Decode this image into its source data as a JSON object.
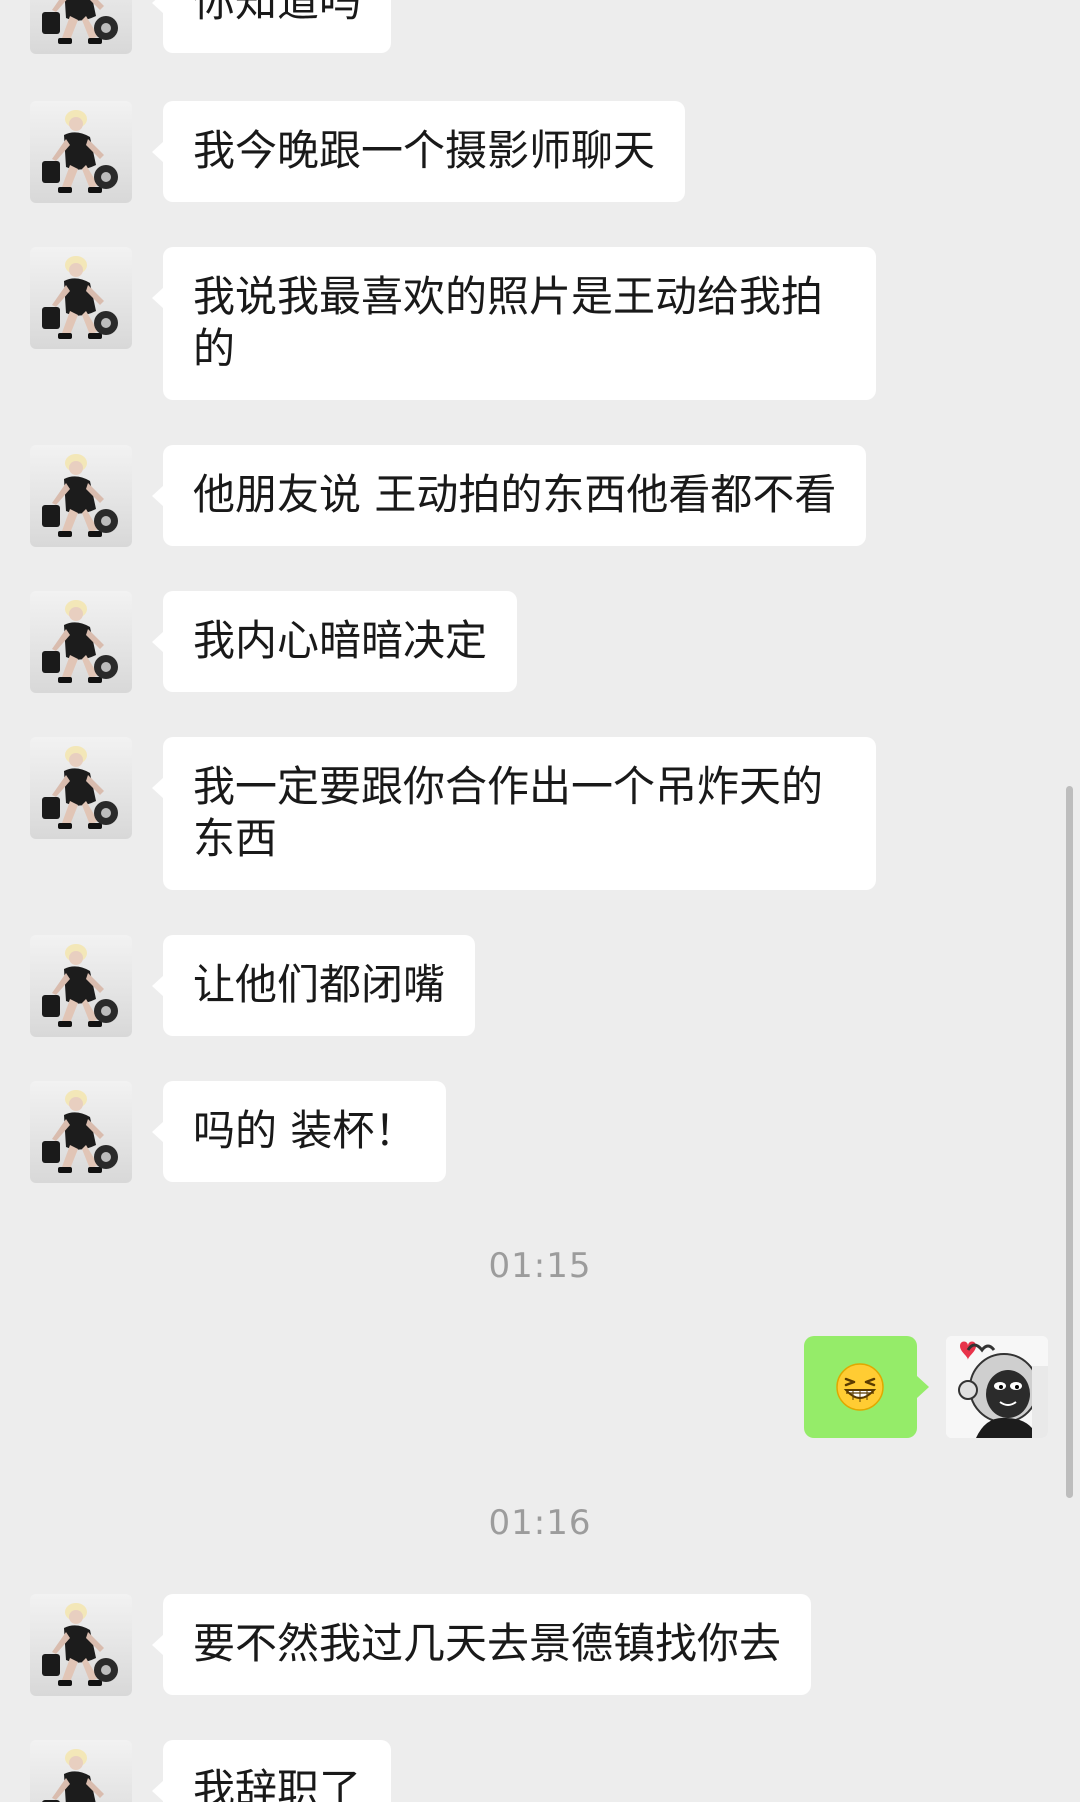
{
  "chat": {
    "colors": {
      "background": "#ededed",
      "received_bubble": "#ffffff",
      "sent_bubble": "#95ec69",
      "timestamp_text": "#9c9c9c"
    },
    "messages": [
      {
        "sender": "other",
        "text": "你知道吗"
      },
      {
        "sender": "other",
        "text": "我今晚跟一个摄影师聊天"
      },
      {
        "sender": "other",
        "text": "我说我最喜欢的照片是王动给我拍的"
      },
      {
        "sender": "other",
        "text": "他朋友说 王动拍的东西他看都不看"
      },
      {
        "sender": "other",
        "text": "我内心暗暗决定"
      },
      {
        "sender": "other",
        "text": "我一定要跟你合作出一个吊炸天的东西"
      },
      {
        "sender": "other",
        "text": "让他们都闭嘴"
      },
      {
        "sender": "other",
        "text": "吗的 装杯！"
      },
      {
        "type": "time",
        "text": "01:15"
      },
      {
        "sender": "me",
        "emoji": "grinning-squinting-emoji"
      },
      {
        "type": "time",
        "text": "01:16"
      },
      {
        "sender": "other",
        "text": "要不然我过几天去景德镇找你去"
      },
      {
        "sender": "other",
        "text": "我辞职了"
      }
    ]
  }
}
